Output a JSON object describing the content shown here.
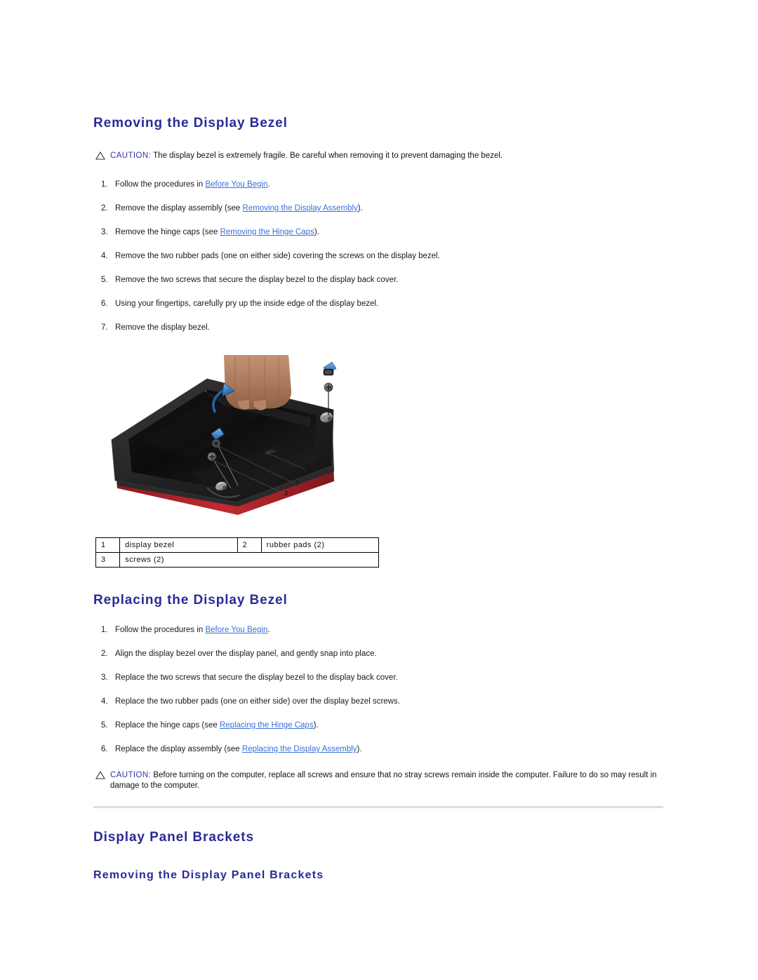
{
  "document": {
    "section1_title": "Removing the Display Bezel",
    "section2_title": "Replacing the Display Bezel",
    "section3_title": "Display Panel Brackets",
    "section3_sub_title": "Removing the Display Panel Brackets"
  },
  "caution_top": {
    "label": "CAUTION:",
    "text": " The display bezel is extremely fragile. Be careful when removing it to prevent damaging the bezel."
  },
  "caution_bottom": {
    "label": "CAUTION:",
    "text": " Before turning on the computer, replace all screws and ensure that no stray screws remain inside the computer. Failure to do so may result in damage to the computer."
  },
  "removing_steps": [
    {
      "num": "1.",
      "pre": "Follow the procedures in ",
      "link": "Before You Begin",
      "post": "."
    },
    {
      "num": "2.",
      "pre": "Remove the display assembly (see ",
      "link": "Removing the Display Assembly",
      "post": ")."
    },
    {
      "num": "3.",
      "pre": "Remove the hinge caps (see ",
      "link": "Removing the Hinge Caps",
      "post": ")."
    },
    {
      "num": "4.",
      "pre": "Remove the two rubber pads (one on either side) covering the screws on the display bezel.",
      "link": "",
      "post": ""
    },
    {
      "num": "5.",
      "pre": "Remove the two screws that secure the display bezel to the display back cover.",
      "link": "",
      "post": ""
    },
    {
      "num": "6.",
      "pre": "Using your fingertips, carefully pry up the inside edge of the display bezel.",
      "link": "",
      "post": ""
    },
    {
      "num": "7.",
      "pre": "Remove the display bezel.",
      "link": "",
      "post": ""
    }
  ],
  "replacing_steps": [
    {
      "num": "1.",
      "pre": "Follow the procedures in ",
      "link": "Before You Begin",
      "post": "."
    },
    {
      "num": "2.",
      "pre": "Align the display bezel over the display panel, and gently snap into place.",
      "link": "",
      "post": ""
    },
    {
      "num": "3.",
      "pre": "Replace the two screws that secure the display bezel to the display back cover.",
      "link": "",
      "post": ""
    },
    {
      "num": "4.",
      "pre": "Replace the two rubber pads (one on either side) over the display bezel screws.",
      "link": "",
      "post": ""
    },
    {
      "num": "5.",
      "pre": "Replace the hinge caps (see ",
      "link": "Replacing the Hinge Caps",
      "post": ")."
    },
    {
      "num": "6.",
      "pre": "Replace the display assembly (see ",
      "link": "Replacing the Display Assembly",
      "post": ")."
    }
  ],
  "figure": {
    "alt": "Display bezel removal illustration",
    "callouts": [
      "1",
      "2",
      "3"
    ]
  },
  "legend": {
    "rows": [
      [
        {
          "key": "1",
          "value": "display bezel"
        },
        {
          "key": "2",
          "value": "rubber pads (2)"
        }
      ],
      [
        {
          "key": "3",
          "value": "screws (2)"
        }
      ]
    ]
  },
  "colors": {
    "heading": "#2a2a95",
    "link": "#3a6fd8",
    "caution_label": "#3333aa",
    "rule": "#dddddd",
    "bezel_red": "#b5222b",
    "arrow_blue": "#2f6fc4"
  }
}
